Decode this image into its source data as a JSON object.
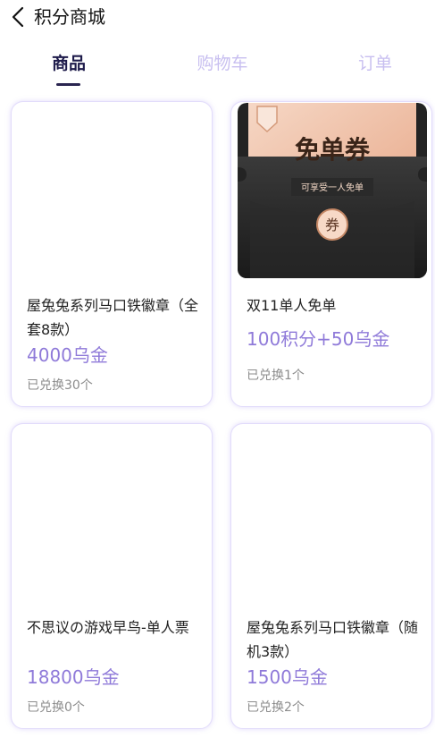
{
  "header": {
    "title": "积分商城"
  },
  "tabs": [
    {
      "label": "商品",
      "active": true
    },
    {
      "label": "购物车",
      "active": false
    },
    {
      "label": "订单",
      "active": false
    }
  ],
  "products": [
    {
      "name": "屋兔兔系列马口铁徽章（全套8款）",
      "price": "4000乌金",
      "redeemed": "已兑换30个"
    },
    {
      "name": "双11单人免单",
      "price": "100积分+50乌金",
      "redeemed": "已兑换1个",
      "image_text": {
        "headline": "免单券",
        "subline": "可享受一人免单",
        "badge": "券"
      }
    },
    {
      "name": "不思议の游戏早鸟-单人票",
      "price": "18800乌金",
      "redeemed": "已兑换0个"
    },
    {
      "name": "屋兔兔系列马口铁徽章（随机3款）",
      "price": "1500乌金",
      "redeemed": "已兑换2个"
    }
  ],
  "colors": {
    "accent": "#8f7ad9",
    "tab_inactive": "#c8bff0",
    "tab_active": "#1e1b4b"
  },
  "icons": {
    "back": "chevron-left-icon"
  }
}
